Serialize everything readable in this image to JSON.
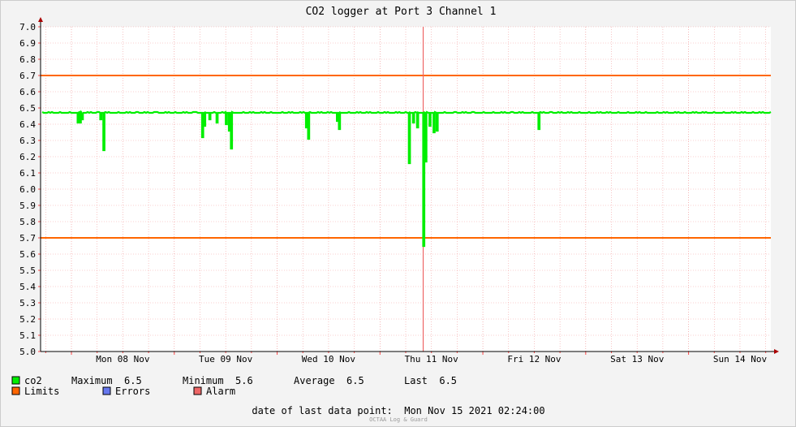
{
  "chart_data": {
    "type": "line",
    "title": "CO2 logger at Port 3 Channel 1",
    "ylim": [
      5.0,
      7.0
    ],
    "yticks": [
      "5.0",
      "5.1",
      "5.2",
      "5.3",
      "5.4",
      "5.5",
      "5.6",
      "5.7",
      "5.8",
      "5.9",
      "6.0",
      "6.1",
      "6.2",
      "6.3",
      "6.4",
      "6.5",
      "6.6",
      "6.7",
      "6.8",
      "6.9",
      "7.0"
    ],
    "xlim_days": [
      7.7,
      14.8
    ],
    "xticks": [
      {
        "label": "Mon 08 Nov",
        "day": 8.5
      },
      {
        "label": "Tue 09 Nov",
        "day": 9.5
      },
      {
        "label": "Wed 10 Nov",
        "day": 10.5
      },
      {
        "label": "Thu 11 Nov",
        "day": 11.5
      },
      {
        "label": "Fri 12 Nov",
        "day": 12.5
      },
      {
        "label": "Sat 13 Nov",
        "day": 13.5
      },
      {
        "label": "Sun 14 Nov",
        "day": 14.5
      }
    ],
    "limits": [
      6.7,
      5.7
    ],
    "alarm_day": 11.42,
    "series": [
      {
        "name": "co2",
        "color": "#00ee00",
        "baseline": 6.47,
        "dips": [
          {
            "day": 8.06,
            "value": 6.41
          },
          {
            "day": 8.08,
            "value": 6.41
          },
          {
            "day": 8.1,
            "value": 6.43
          },
          {
            "day": 8.28,
            "value": 6.43
          },
          {
            "day": 8.31,
            "value": 6.24
          },
          {
            "day": 9.27,
            "value": 6.32
          },
          {
            "day": 9.29,
            "value": 6.39
          },
          {
            "day": 9.34,
            "value": 6.43
          },
          {
            "day": 9.41,
            "value": 6.41
          },
          {
            "day": 9.5,
            "value": 6.4
          },
          {
            "day": 9.53,
            "value": 6.36
          },
          {
            "day": 9.55,
            "value": 6.25
          },
          {
            "day": 10.28,
            "value": 6.38
          },
          {
            "day": 10.3,
            "value": 6.31
          },
          {
            "day": 10.58,
            "value": 6.42
          },
          {
            "day": 10.6,
            "value": 6.37
          },
          {
            "day": 11.28,
            "value": 6.16
          },
          {
            "day": 11.32,
            "value": 6.41
          },
          {
            "day": 11.36,
            "value": 6.38
          },
          {
            "day": 11.42,
            "value": 5.65
          },
          {
            "day": 11.44,
            "value": 6.17
          },
          {
            "day": 11.48,
            "value": 6.39
          },
          {
            "day": 11.52,
            "value": 6.35
          },
          {
            "day": 11.55,
            "value": 6.36
          },
          {
            "day": 12.54,
            "value": 6.37
          }
        ]
      }
    ]
  },
  "legend": {
    "co2": {
      "label": "co2",
      "color": "#00ee00"
    },
    "maximum": "Maximum  6.5",
    "minimum": "Minimum  5.6",
    "average": "Average  6.5",
    "last": "Last  6.5",
    "limits": {
      "label": "Limits",
      "color": "#ff6600"
    },
    "errors": {
      "label": "Errors",
      "color": "#6677ee"
    },
    "alarm": {
      "label": "Alarm",
      "color": "#ee6666"
    }
  },
  "footer": {
    "last_point": "date of last data point:  Mon Nov 15 2021 02:24:00",
    "watermark": "OCTAA Log & Guard"
  }
}
